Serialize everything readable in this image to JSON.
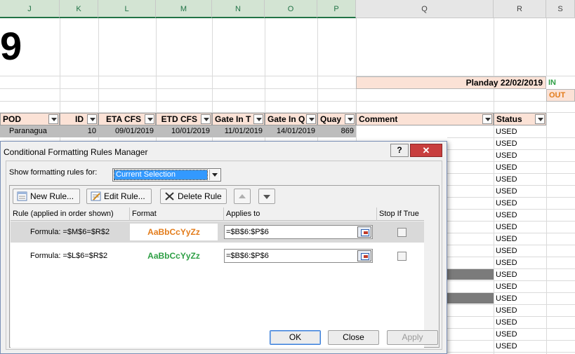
{
  "sheet": {
    "columns": [
      "J",
      "K",
      "L",
      "M",
      "N",
      "O",
      "P",
      "Q",
      "R",
      "S"
    ],
    "big_number": "9",
    "planday_label": "Planday  22/02/2019",
    "in_label": "IN",
    "out_label": "OUT",
    "headers": {
      "pod": "POD",
      "id": "ID",
      "eta": "ETA CFS",
      "etd": "ETD CFS",
      "gate_in_t": "Gate In T",
      "gate_in_q": "Gate In Q",
      "quay": "Quay",
      "comment": "Comment",
      "status": "Status"
    },
    "first_row": {
      "pod": "Paranagua",
      "id": "10",
      "eta": "09/01/2019",
      "etd": "10/01/2019",
      "gate_in_t": "11/01/2019",
      "gate_in_q": "14/01/2019",
      "quay": "869"
    },
    "status_values": [
      "USED",
      "USED",
      "USED",
      "USED",
      "USED",
      "USED",
      "USED",
      "USED",
      "USED",
      "USED",
      "USED",
      "USED",
      "USED",
      "USED",
      "USED",
      "USED",
      "USED",
      "USED",
      "USED"
    ]
  },
  "dialog": {
    "title": "Conditional Formatting Rules Manager",
    "help_symbol": "?",
    "close_symbol": "✕",
    "show_rules_label": "Show formatting rules for:",
    "show_rules_value": "Current Selection",
    "new_rule": "New Rule...",
    "edit_rule": "Edit Rule...",
    "delete_rule": "Delete Rule",
    "col_rule": "Rule (applied in order shown)",
    "col_format": "Format",
    "col_applies": "Applies to",
    "col_stop": "Stop If True",
    "rules": [
      {
        "formula": "Formula: =$M$6=$R$2",
        "preview": "AaBbCcYyZz",
        "preview_color": "#e37c1b",
        "applies_to": "=$B$6:$P$6",
        "stop_if_true": false
      },
      {
        "formula": "Formula: =$L$6=$R$2",
        "preview": "AaBbCcYyZz",
        "preview_color": "#2e9f45",
        "applies_to": "=$B$6:$P$6",
        "stop_if_true": false
      }
    ],
    "ok": "OK",
    "close": "Close",
    "apply": "Apply"
  }
}
